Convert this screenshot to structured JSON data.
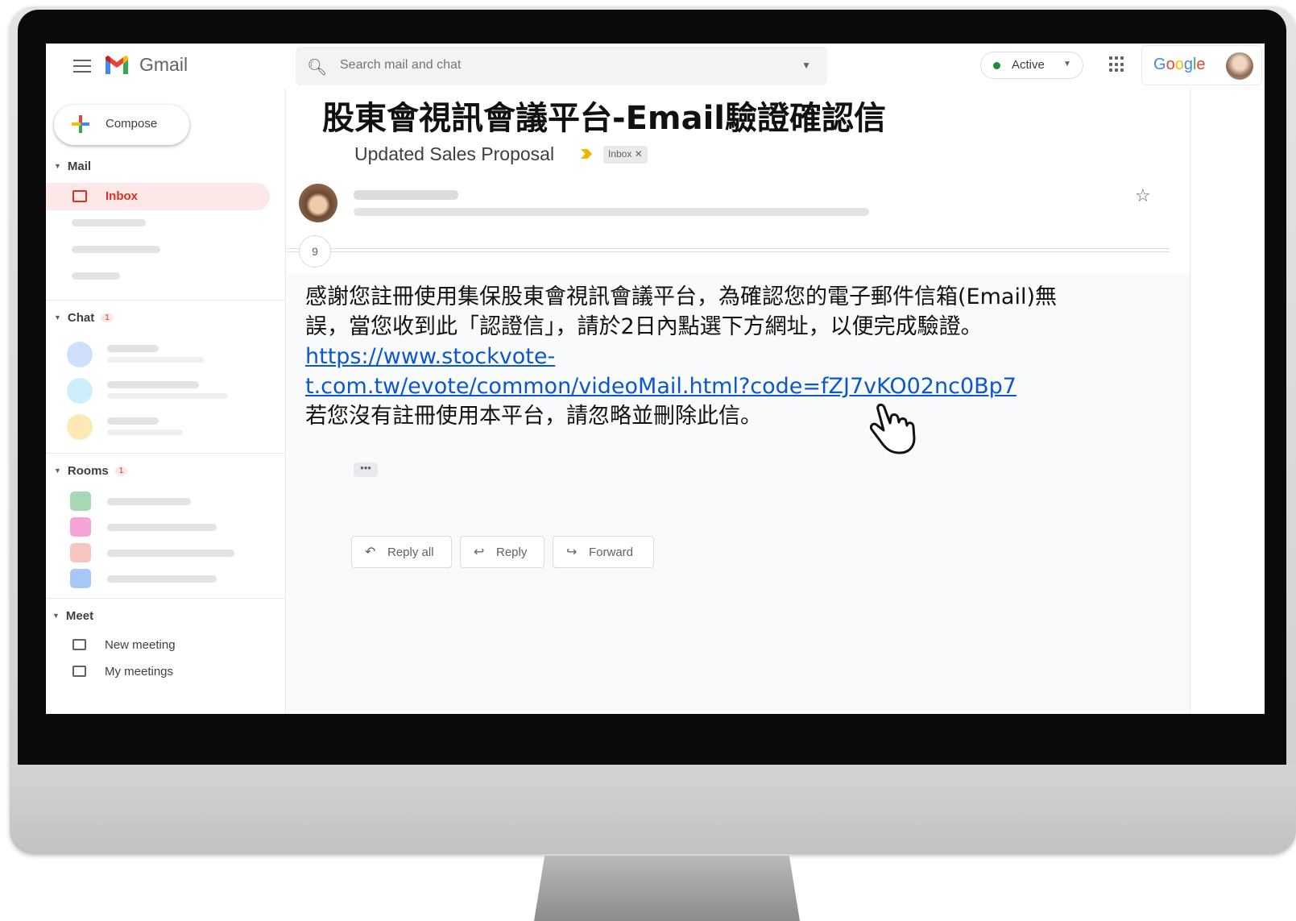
{
  "app": {
    "name": "Gmail"
  },
  "search": {
    "placeholder": "Search mail and chat"
  },
  "status": {
    "label": "Active"
  },
  "account": {
    "brand": "Google"
  },
  "sidebar": {
    "compose_label": "Compose",
    "mail_section": "Mail",
    "inbox_label": "Inbox",
    "chat_section": "Chat",
    "chat_badge": "1",
    "rooms_section": "Rooms",
    "rooms_badge": "1",
    "meet_section": "Meet",
    "meet_items": [
      "New meeting",
      "My meetings"
    ]
  },
  "email": {
    "overlay_title": "股東會視訊會議平台-Email驗證確認信",
    "subject": "Updated Sales Proposal",
    "label_chip": "Inbox ✕",
    "thread_count": "9",
    "body_line1": "感謝您註冊使用集保股東會視訊會議平台，為確認您的電子郵件信箱(Email)無",
    "body_line2": "誤，當您收到此「認證信」，請於2日內點選下方網址，以便完成驗證。",
    "link_line1": "https://www.stockvote-",
    "link_line2": "t.com.tw/evote/common/videoMail.html?code=fZJ7vKO02nc0Bp7",
    "body_line3": "若您沒有註冊使用本平台，請忽略並刪除此信。",
    "ellipsis": "•••"
  },
  "actions": {
    "reply_all": "Reply all",
    "reply": "Reply",
    "forward": "Forward"
  },
  "colors": {
    "accent_red": "#d93025",
    "link_blue": "#0b57d0",
    "active_green": "#1e8e3e",
    "important_yellow": "#f4b400"
  },
  "icons": [
    "menu-icon",
    "gmail-logo-icon",
    "search-icon",
    "chevron-down-icon",
    "apps-icon",
    "compose-plus-icon",
    "inbox-icon",
    "star-icon",
    "reply-all-icon",
    "reply-icon",
    "forward-icon",
    "video-meeting-icon",
    "calendar-icon",
    "hand-cursor-icon"
  ]
}
